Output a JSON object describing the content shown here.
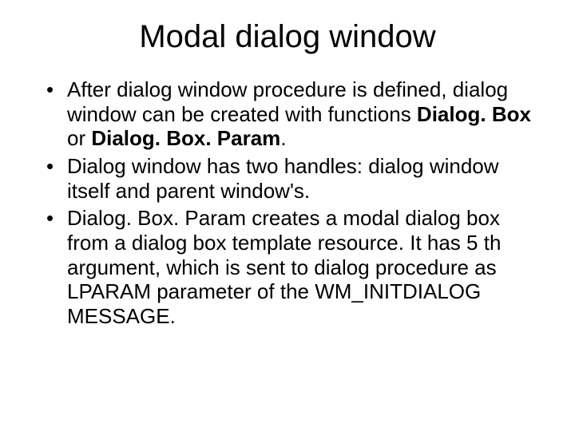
{
  "title": "Modal dialog window",
  "bullets": [
    {
      "pre": "After dialog window procedure is defined, dialog window can be created with functions ",
      "bold1": "Dialog. Box",
      "mid": " or ",
      "bold2": "Dialog. Box. Param",
      "post": ". "
    },
    {
      "text": "Dialog window has two handles: dialog window itself and parent window's. "
    },
    {
      "text": "Dialog. Box. Param creates a modal dialog box from a dialog box template resource. It has 5 th argument, which is sent to dialog procedure as LPARAM parameter of the WM_INITDIALOG MESSAGE. "
    }
  ]
}
